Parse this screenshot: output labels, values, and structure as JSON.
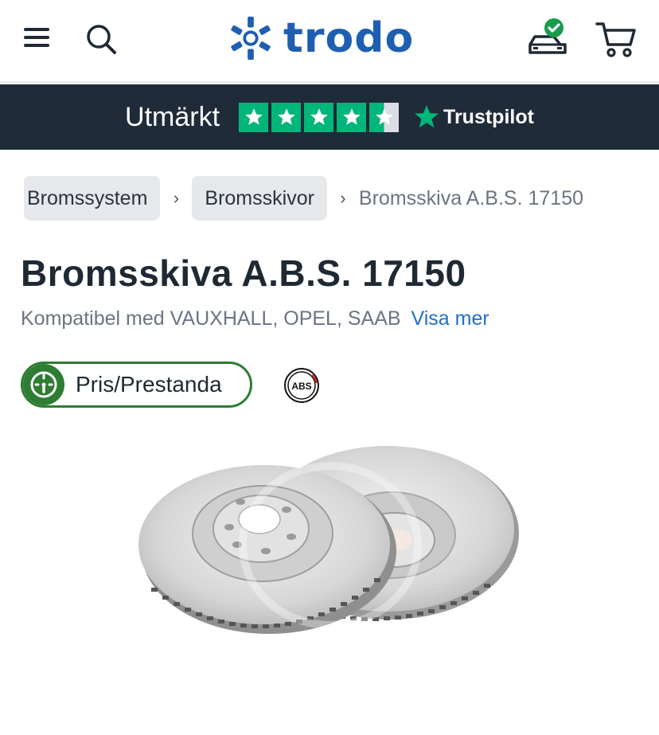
{
  "header": {
    "logo_text": "trodo",
    "icons": [
      "menu-icon",
      "search-icon",
      "garage-car-icon",
      "cart-icon"
    ],
    "brand_color": "#1f5fb2"
  },
  "trustpilot": {
    "rating_word": "Utmärkt",
    "brand": "Trustpilot",
    "stars": 4.5,
    "star_color": "#00b67a",
    "bar_color": "#1f2b38"
  },
  "breadcrumb": {
    "items": [
      "Bromssystem",
      "Bromsskivor"
    ],
    "current": "Bromsskiva A.B.S. 17150"
  },
  "product": {
    "title": "Bromsskiva A.B.S. 17150",
    "compat_text": "Kompatibel med VAUXHALL, OPEL, SAAB",
    "see_more": "Visa mer",
    "value_badge": "Pris/Prestanda",
    "brand_logo_text": "ABS",
    "image_icon": "brake-disc-image"
  }
}
